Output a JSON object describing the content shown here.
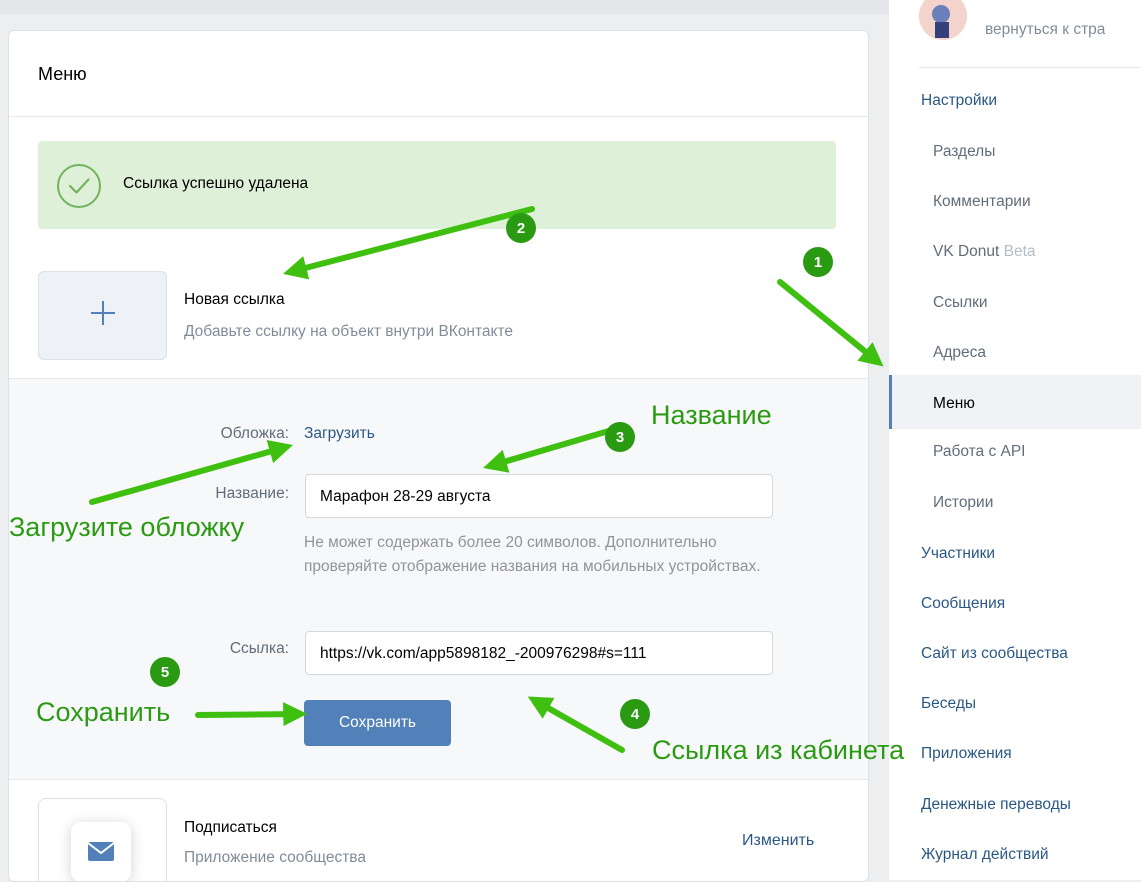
{
  "main": {
    "title": "Меню",
    "success_message": "Ссылка успешно удалена",
    "new_link": {
      "title": "Новая ссылка",
      "subtitle": "Добавьте ссылку на объект внутри ВКонтакте"
    },
    "form": {
      "cover_label": "Обложка:",
      "cover_action": "Загрузить",
      "name_label": "Название:",
      "name_value": "Марафон 28-29 августа",
      "name_hint": "Не может содержать более 20 символов. Дополнительно проверяйте отображение названия на мобильных устройствах.",
      "link_label": "Ссылка:",
      "link_value": "https://vk.com/app5898182_-200976298#s=111",
      "save_label": "Сохранить"
    },
    "subscribe": {
      "title": "Подписаться",
      "subtitle": "Приложение сообщества",
      "edit_label": "Изменить"
    }
  },
  "sidebar": {
    "back_text": "вернуться к стра",
    "items": [
      {
        "label": "Настройки",
        "level": "top"
      },
      {
        "label": "Разделы",
        "level": "sub"
      },
      {
        "label": "Комментарии",
        "level": "sub"
      },
      {
        "label": "VK Donut",
        "badge": "Beta",
        "level": "sub"
      },
      {
        "label": "Ссылки",
        "level": "sub"
      },
      {
        "label": "Адреса",
        "level": "sub"
      },
      {
        "label": "Меню",
        "level": "active"
      },
      {
        "label": "Работа с API",
        "level": "sub"
      },
      {
        "label": "Истории",
        "level": "sub"
      },
      {
        "label": "Участники",
        "level": "top"
      },
      {
        "label": "Сообщения",
        "level": "top"
      },
      {
        "label": "Сайт из сообщества",
        "level": "top"
      },
      {
        "label": "Беседы",
        "level": "top"
      },
      {
        "label": "Приложения",
        "level": "top"
      },
      {
        "label": "Денежные переводы",
        "level": "top"
      },
      {
        "label": "Журнал действий",
        "level": "top"
      }
    ]
  },
  "annotations": {
    "steps": [
      "1",
      "2",
      "3",
      "4",
      "5"
    ],
    "name_label": "Название",
    "cover_label": "Загрузите обложку",
    "save_label": "Сохранить",
    "link_label": "Ссылка из кабинета"
  },
  "colors": {
    "accent": "#5181b8",
    "link": "#2a5885",
    "success_bg": "#dff0d8",
    "annotation_green": "#2a9a13"
  }
}
